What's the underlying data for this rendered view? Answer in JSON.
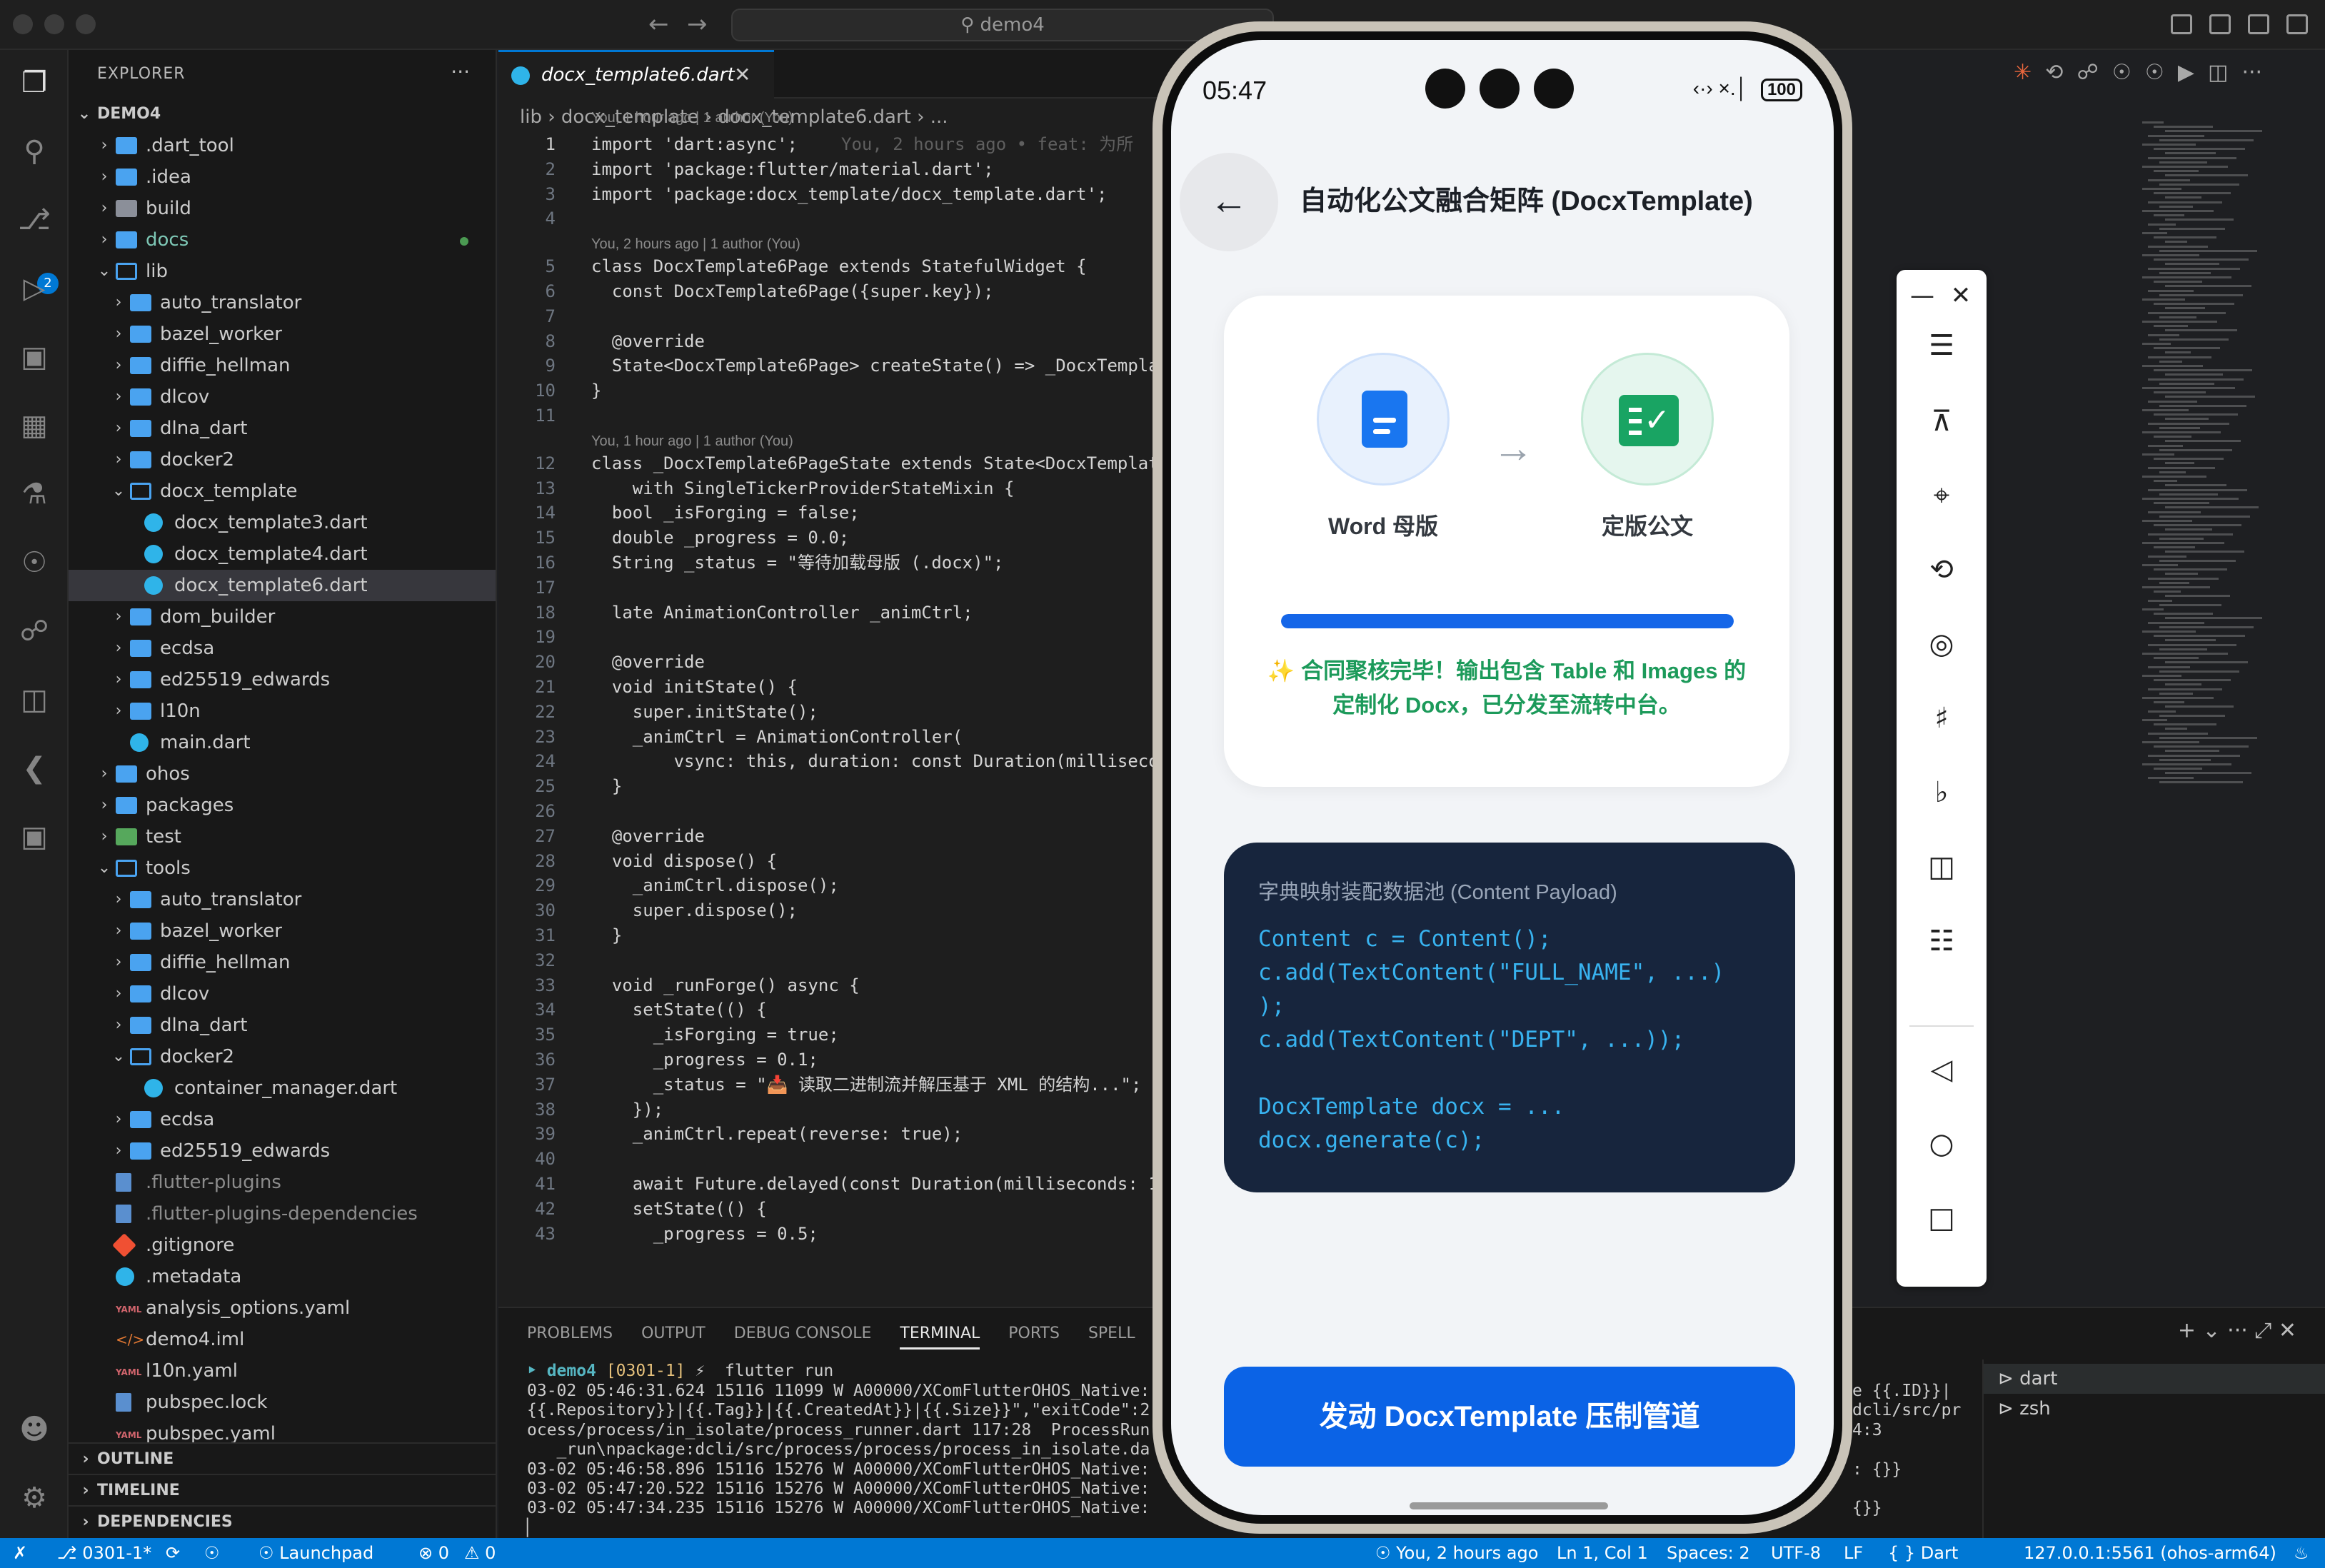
{
  "window": {
    "search_text": "demo4"
  },
  "explorer": {
    "title": "EXPLORER",
    "more": "···",
    "root": "DEMO4",
    "tree": [
      {
        "name": ".dart_tool",
        "type": "folder",
        "depth": 1,
        "open": false
      },
      {
        "name": ".idea",
        "type": "folder",
        "depth": 1,
        "open": false
      },
      {
        "name": "build",
        "type": "folder-gray",
        "depth": 1,
        "open": false
      },
      {
        "name": "docs",
        "type": "folder",
        "depth": 1,
        "open": false,
        "modified": true
      },
      {
        "name": "lib",
        "type": "folder",
        "depth": 1,
        "open": true
      },
      {
        "name": "auto_translator",
        "type": "folder",
        "depth": 2,
        "open": false
      },
      {
        "name": "bazel_worker",
        "type": "folder",
        "depth": 2,
        "open": false
      },
      {
        "name": "diffie_hellman",
        "type": "folder",
        "depth": 2,
        "open": false
      },
      {
        "name": "dlcov",
        "type": "folder",
        "depth": 2,
        "open": false
      },
      {
        "name": "dlna_dart",
        "type": "folder",
        "depth": 2,
        "open": false
      },
      {
        "name": "docker2",
        "type": "folder",
        "depth": 2,
        "open": false
      },
      {
        "name": "docx_template",
        "type": "folder",
        "depth": 2,
        "open": true
      },
      {
        "name": "docx_template3.dart",
        "type": "dart",
        "depth": 3
      },
      {
        "name": "docx_template4.dart",
        "type": "dart",
        "depth": 3
      },
      {
        "name": "docx_template6.dart",
        "type": "dart",
        "depth": 3,
        "selected": true
      },
      {
        "name": "dom_builder",
        "type": "folder",
        "depth": 2,
        "open": false
      },
      {
        "name": "ecdsa",
        "type": "folder",
        "depth": 2,
        "open": false
      },
      {
        "name": "ed25519_edwards",
        "type": "folder",
        "depth": 2,
        "open": false
      },
      {
        "name": "l10n",
        "type": "folder",
        "depth": 2,
        "open": false
      },
      {
        "name": "main.dart",
        "type": "dart",
        "depth": 2
      },
      {
        "name": "ohos",
        "type": "folder",
        "depth": 1,
        "open": false
      },
      {
        "name": "packages",
        "type": "folder",
        "depth": 1,
        "open": false
      },
      {
        "name": "test",
        "type": "folder-green",
        "depth": 1,
        "open": false
      },
      {
        "name": "tools",
        "type": "folder",
        "depth": 1,
        "open": true
      },
      {
        "name": "auto_translator",
        "type": "folder",
        "depth": 2,
        "open": false
      },
      {
        "name": "bazel_worker",
        "type": "folder",
        "depth": 2,
        "open": false
      },
      {
        "name": "diffie_hellman",
        "type": "folder",
        "depth": 2,
        "open": false
      },
      {
        "name": "dlcov",
        "type": "folder",
        "depth": 2,
        "open": false
      },
      {
        "name": "dlna_dart",
        "type": "folder",
        "depth": 2,
        "open": false
      },
      {
        "name": "docker2",
        "type": "folder",
        "depth": 2,
        "open": true
      },
      {
        "name": "container_manager.dart",
        "type": "dart",
        "depth": 3
      },
      {
        "name": "ecdsa",
        "type": "folder",
        "depth": 2,
        "open": false
      },
      {
        "name": "ed25519_edwards",
        "type": "folder",
        "depth": 2,
        "open": false
      },
      {
        "name": ".flutter-plugins",
        "type": "doc",
        "depth": 1,
        "muted": true
      },
      {
        "name": ".flutter-plugins-dependencies",
        "type": "doc",
        "depth": 1,
        "muted": true
      },
      {
        "name": ".gitignore",
        "type": "git",
        "depth": 1
      },
      {
        "name": ".metadata",
        "type": "dart",
        "depth": 1
      },
      {
        "name": "analysis_options.yaml",
        "type": "yaml",
        "depth": 1
      },
      {
        "name": "demo4.iml",
        "type": "xml",
        "depth": 1
      },
      {
        "name": "l10n.yaml",
        "type": "yaml",
        "depth": 1
      },
      {
        "name": "pubspec.lock",
        "type": "doc",
        "depth": 1
      },
      {
        "name": "pubspec.yaml",
        "type": "yaml",
        "depth": 1
      }
    ],
    "sections": [
      "OUTLINE",
      "TIMELINE",
      "DEPENDENCIES"
    ]
  },
  "editor": {
    "tab_label": "docx_template6.dart",
    "breadcrumb": "lib  ›  docx_template  ›  docx_template6.dart  ›  ...",
    "blame_top": "You, 1 hour ago | 1 author (You)",
    "inline_blame": "You, 2 hours ago • feat: 为所",
    "lines": [
      {
        "n": "1",
        "t": "import 'dart:async';"
      },
      {
        "n": "2",
        "t": "import 'package:flutter/material.dart';"
      },
      {
        "n": "3",
        "t": "import 'package:docx_template/docx_template.dart';"
      },
      {
        "n": "4",
        "t": ""
      },
      {
        "n": "5",
        "t": "class DocxTemplate6Page extends StatefulWidget {",
        "blame": "You, 2 hours ago | 1 author (You)"
      },
      {
        "n": "6",
        "t": "  const DocxTemplate6Page({super.key});"
      },
      {
        "n": "7",
        "t": ""
      },
      {
        "n": "8",
        "t": "  @override"
      },
      {
        "n": "9",
        "t": "  State<DocxTemplate6Page> createState() => _DocxTempla"
      },
      {
        "n": "10",
        "t": "}"
      },
      {
        "n": "11",
        "t": ""
      },
      {
        "n": "12",
        "t": "class _DocxTemplate6PageState extends State<DocxTemplat",
        "blame": "You, 1 hour ago | 1 author (You)"
      },
      {
        "n": "13",
        "t": "    with SingleTickerProviderStateMixin {"
      },
      {
        "n": "14",
        "t": "  bool _isForging = false;"
      },
      {
        "n": "15",
        "t": "  double _progress = 0.0;"
      },
      {
        "n": "16",
        "t": "  String _status = \"等待加载母版 (.docx)\";"
      },
      {
        "n": "17",
        "t": ""
      },
      {
        "n": "18",
        "t": "  late AnimationController _animCtrl;"
      },
      {
        "n": "19",
        "t": ""
      },
      {
        "n": "20",
        "t": "  @override"
      },
      {
        "n": "21",
        "t": "  void initState() {"
      },
      {
        "n": "22",
        "t": "    super.initState();"
      },
      {
        "n": "23",
        "t": "    _animCtrl = AnimationController("
      },
      {
        "n": "24",
        "t": "        vsync: this, duration: const Duration(millisecon"
      },
      {
        "n": "25",
        "t": "  }"
      },
      {
        "n": "26",
        "t": ""
      },
      {
        "n": "27",
        "t": "  @override"
      },
      {
        "n": "28",
        "t": "  void dispose() {"
      },
      {
        "n": "29",
        "t": "    _animCtrl.dispose();"
      },
      {
        "n": "30",
        "t": "    super.dispose();"
      },
      {
        "n": "31",
        "t": "  }"
      },
      {
        "n": "32",
        "t": ""
      },
      {
        "n": "33",
        "t": "  void _runForge() async {"
      },
      {
        "n": "34",
        "t": "    setState(() {"
      },
      {
        "n": "35",
        "t": "      _isForging = true;"
      },
      {
        "n": "36",
        "t": "      _progress = 0.1;"
      },
      {
        "n": "37",
        "t": "      _status = \"📥 读取二进制流并解压基于 XML 的结构...\";"
      },
      {
        "n": "38",
        "t": "    });"
      },
      {
        "n": "39",
        "t": "    _animCtrl.repeat(reverse: true);"
      },
      {
        "n": "40",
        "t": ""
      },
      {
        "n": "41",
        "t": "    await Future.delayed(const Duration(milliseconds: 1"
      },
      {
        "n": "42",
        "t": "    setState(() {"
      },
      {
        "n": "43",
        "t": "      _progress = 0.5;"
      }
    ]
  },
  "panel": {
    "tabs": [
      "PROBLEMS",
      "OUTPUT",
      "DEBUG CONSOLE",
      "TERMINAL",
      "PORTS",
      "SPELL"
    ],
    "active_tab": "TERMINAL",
    "prompt_dir": "demo4",
    "prompt_branch": "[0301-1]",
    "prompt_cmd": "⚡  flutter run",
    "lines": [
      "03-02 05:46:31.624 15116 11099 W A00000/XComFlutterOHOS_Native:",
      "{{.Repository}}|{{.Tag}}|{{.CreatedAt}}|{{.Size}}\",\"exitCode\":2",
      "ocess/process/in_isolate/process_runner.dart 117:28  ProcessRun",
      "   _run\\npackage:dcli/src/process/process/process_in_isolate.da",
      "03-02 05:46:58.896 15116 15276 W A00000/XComFlutterOHOS_Native:",
      "03-02 05:47:20.522 15116 15276 W A00000/XComFlutterOHOS_Native:",
      "03-02 05:47:34.235 15116 15276 W A00000/XComFlutterOHOS_Native:"
    ],
    "right_lines": [
      "e {{.ID}}|",
      "dcli/src/pr",
      "4:3",
      "",
      ": {}}",
      "",
      "{}}"
    ],
    "terminals": [
      "dart",
      "zsh"
    ],
    "actions": "+ ⌄   ···   ⤢   ✕"
  },
  "statusbar": {
    "branch": "0301-1*",
    "sync": "⟳",
    "launchpad": "Launchpad",
    "errors": "⊗ 0",
    "warnings": "⚠ 0",
    "blame": "You, 2 hours ago",
    "position": "Ln 1, Col 1",
    "spaces": "Spaces: 2",
    "encoding": "UTF-8",
    "eol": "LF",
    "language": "{ }  Dart",
    "device": "127.0.0.1:5561 (ohos-arm64)"
  },
  "phone": {
    "time": "05:47",
    "battery": "100",
    "signal": "‹·›  ×.│",
    "app_title": "自动化公文融合矩阵 (DocxTemplate)",
    "source_label": "Word 母版",
    "target_label": "定版公文",
    "progress": 1.0,
    "status_message": "✨ 合同聚核完毕！输出包含 Table 和 Images 的定制化 Docx，已分发至流转中台。",
    "payload_title": "字典映射装配数据池 (Content Payload)",
    "payload_code": "Content c = Content();\nc.add(TextContent(\"FULL_NAME\", ...)\n);\nc.add(TextContent(\"DEPT\", ...));\n\nDocxTemplate docx = ...\ndocx.generate(c);",
    "cta_label": "发动 DocxTemplate 压制管道",
    "colors": {
      "primary": "#0b63e6",
      "success": "#1c9a5a",
      "payload_bg": "#17253d"
    }
  },
  "emulator_toolbar": {
    "items": [
      "minimize-icon",
      "close-icon",
      "menu-icon",
      "pin-icon",
      "crop-icon",
      "rotate-icon",
      "screenshot-icon",
      "volume-up-icon",
      "volume-down-icon",
      "shake-icon",
      "multi-device-icon",
      "back-icon",
      "home-icon",
      "recents-icon"
    ]
  }
}
